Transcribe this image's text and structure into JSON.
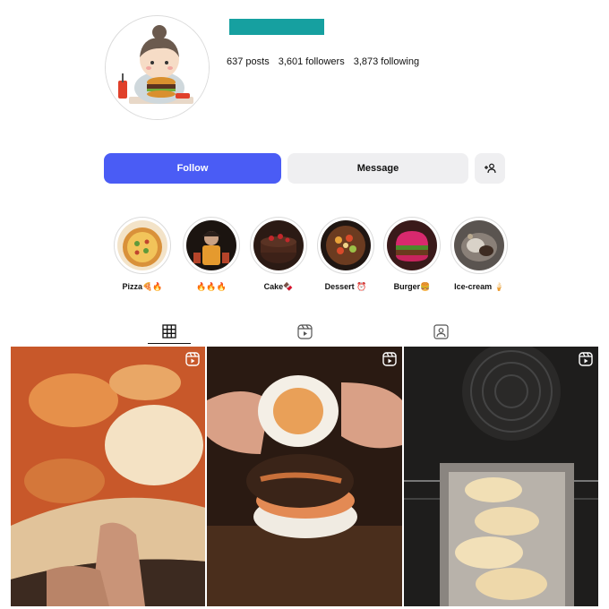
{
  "profile": {
    "avatar_icon": "chibi-girl-eating-burger-avatar",
    "username_color": "#16a0a0",
    "stats": {
      "posts": "637 posts",
      "followers": "3,601 followers",
      "following": "3,873 following"
    }
  },
  "actions": {
    "follow_label": "Follow",
    "message_label": "Message",
    "add_user_icon": "add-user-icon",
    "follow_color": "#4a5cf5"
  },
  "highlights": [
    {
      "label": "Pizza🍕🔥",
      "icon": "pizza-highlight"
    },
    {
      "label": "🔥🔥🔥",
      "icon": "person-highlight"
    },
    {
      "label": "Cake🍫",
      "icon": "chocolate-cake-highlight"
    },
    {
      "label": "Dessert ⏰",
      "icon": "dessert-highlight"
    },
    {
      "label": "Burger🍔",
      "icon": "burger-highlight"
    },
    {
      "label": "Ice-cream 🍦",
      "icon": "ice-cream-highlight"
    }
  ],
  "tabs": [
    {
      "name": "posts",
      "icon": "grid-icon",
      "active": true
    },
    {
      "name": "reels",
      "icon": "reels-icon",
      "active": false
    },
    {
      "name": "tagged",
      "icon": "tagged-icon",
      "active": false
    }
  ],
  "posts": [
    {
      "subject": "pizza-slice-close-up",
      "type": "reel"
    },
    {
      "subject": "egg-burger",
      "type": "reel"
    },
    {
      "subject": "dough-in-oven",
      "type": "reel"
    }
  ]
}
